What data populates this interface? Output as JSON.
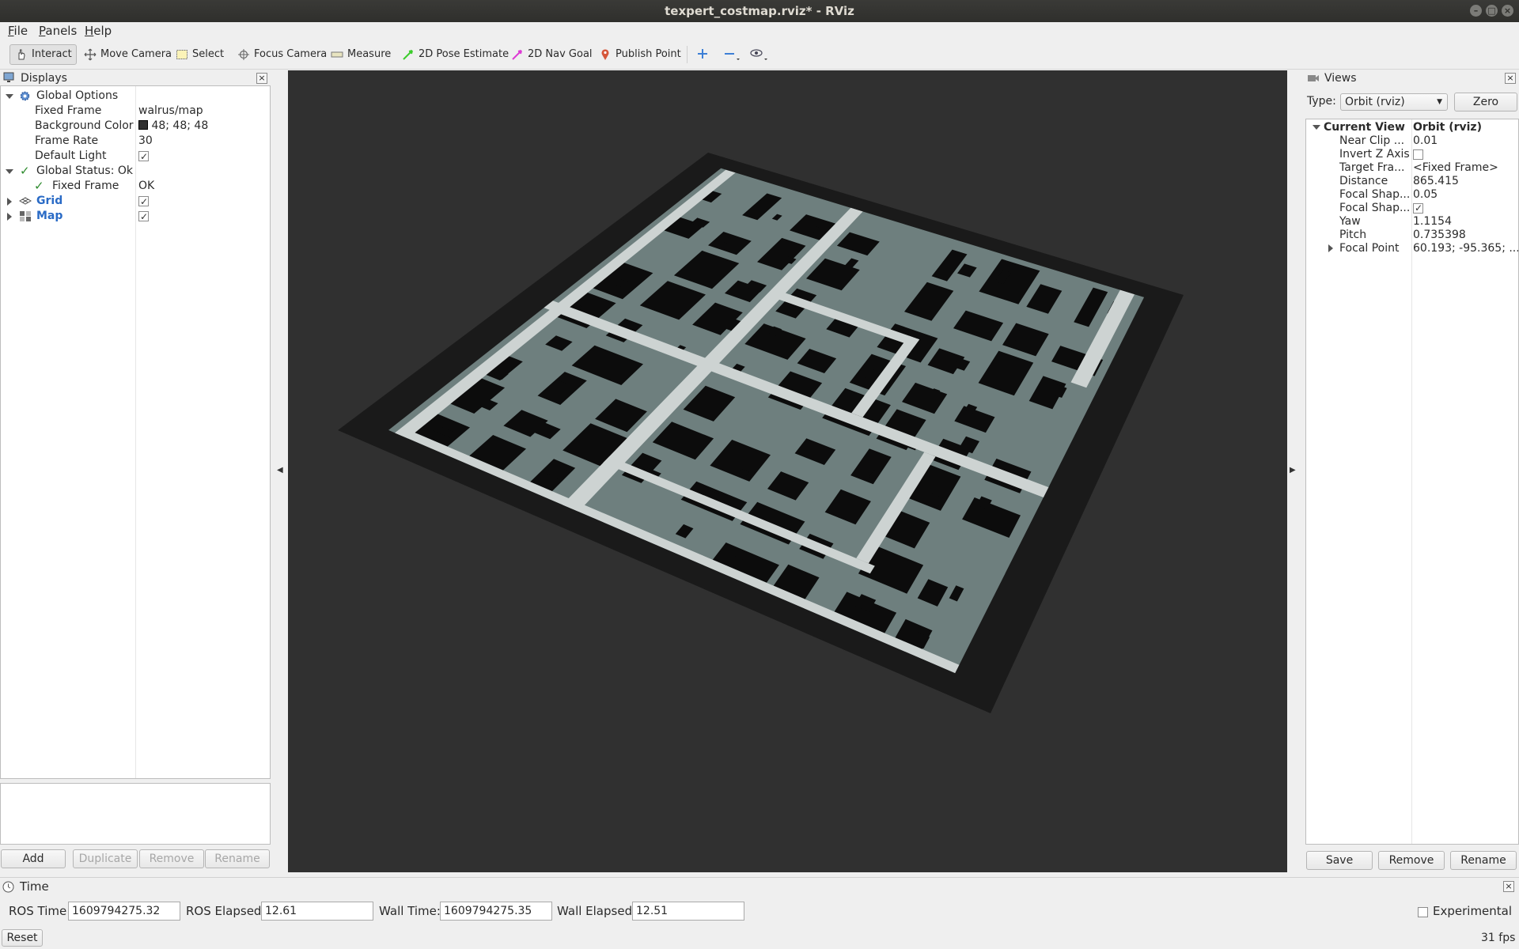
{
  "window": {
    "title": "texpert_costmap.rviz* - RViz"
  },
  "menu": {
    "items": [
      {
        "label": "File"
      },
      {
        "label": "Panels"
      },
      {
        "label": "Help"
      }
    ]
  },
  "toolbar": {
    "tools": [
      {
        "label": "Interact",
        "icon": "hand-pointer-icon",
        "active": true
      },
      {
        "label": "Move Camera",
        "icon": "move-camera-icon"
      },
      {
        "label": "Select",
        "icon": "select-rect-icon"
      },
      {
        "label": "Focus Camera",
        "icon": "focus-camera-icon"
      },
      {
        "label": "Measure",
        "icon": "ruler-icon"
      },
      {
        "label": "2D Pose Estimate",
        "icon": "green-arrow-icon"
      },
      {
        "label": "2D Nav Goal",
        "icon": "pink-arrow-icon"
      },
      {
        "label": "Publish Point",
        "icon": "map-pin-icon"
      }
    ],
    "extra_icons": [
      "add-tool-icon",
      "remove-tool-icon",
      "eye-icon"
    ]
  },
  "displays": {
    "title": "Displays",
    "global_options": {
      "label": "Global Options",
      "fixed_frame_label": "Fixed Frame",
      "fixed_frame_value": "walrus/map",
      "background_color_label": "Background Color",
      "background_color_value": "48; 48; 48",
      "background_color_swatch": "#303030",
      "frame_rate_label": "Frame Rate",
      "frame_rate_value": "30",
      "default_light_label": "Default Light",
      "default_light_checked": true
    },
    "global_status": {
      "label": "Global Status: Ok",
      "fixed_frame_label": "Fixed Frame",
      "fixed_frame_value": "OK"
    },
    "items": [
      {
        "label": "Grid",
        "enabled": true
      },
      {
        "label": "Map",
        "enabled": true
      }
    ],
    "buttons": {
      "add": "Add",
      "duplicate": "Duplicate",
      "remove": "Remove",
      "rename": "Rename"
    }
  },
  "views": {
    "title": "Views",
    "type_label": "Type:",
    "type_value": "Orbit (rviz)",
    "zero_button": "Zero",
    "current_view_label": "Current View",
    "current_view_value": "Orbit (rviz)",
    "properties": [
      {
        "name": "Near Clip ...",
        "value": "0.01"
      },
      {
        "name": "Invert Z Axis",
        "value": "",
        "checkbox": false
      },
      {
        "name": "Target Fra...",
        "value": "<Fixed Frame>"
      },
      {
        "name": "Distance",
        "value": "865.415"
      },
      {
        "name": "Focal Shap...",
        "value": "0.05"
      },
      {
        "name": "Focal Shap...",
        "value": "",
        "checkbox": true
      },
      {
        "name": "Yaw",
        "value": "1.1154"
      },
      {
        "name": "Pitch",
        "value": "0.735398"
      },
      {
        "name": "Focal Point",
        "value": "60.193; -95.365; ..."
      }
    ],
    "buttons": {
      "save": "Save",
      "remove": "Remove",
      "rename": "Rename"
    }
  },
  "time": {
    "title": "Time",
    "ros_time_label": "ROS Time:",
    "ros_time_value": "1609794275.32",
    "ros_elapsed_label": "ROS Elapsed:",
    "ros_elapsed_value": "12.61",
    "wall_time_label": "Wall Time:",
    "wall_time_value": "1609794275.35",
    "wall_elapsed_label": "Wall Elapsed:",
    "wall_elapsed_value": "12.51",
    "experimental_label": "Experimental",
    "experimental_checked": false,
    "reset_button": "Reset",
    "fps": "31 fps"
  },
  "colors": {
    "viewport_bg": "#303030",
    "map_free": "#6e7f7e",
    "map_occupied": "#0c0c0c",
    "map_road": "#cdd3d2",
    "map_unknown": "#1a1a1a",
    "link_blue": "#2a6bc6"
  }
}
